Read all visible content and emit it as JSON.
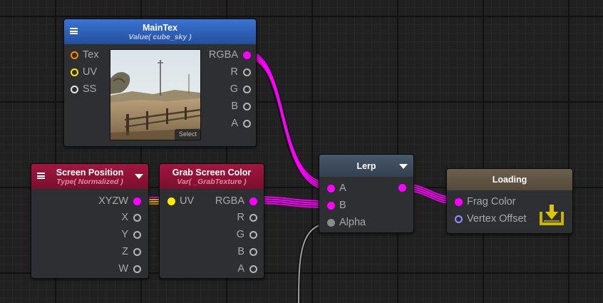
{
  "nodes": {
    "main_tex": {
      "title": "MainTex",
      "subtitle": "Value( cube_sky )",
      "inputs": [
        "Tex",
        "UV",
        "SS"
      ],
      "outputs": [
        "RGBA",
        "R",
        "G",
        "B",
        "A"
      ],
      "select_label": "Select"
    },
    "screen_position": {
      "title": "Screen Position",
      "subtitle": "Type( Normalized )",
      "outputs": [
        "XYZW",
        "X",
        "Y",
        "Z",
        "W"
      ]
    },
    "grab_screen_color": {
      "title": "Grab Screen Color",
      "subtitle": "Var( _GrabTexture )",
      "inputs": [
        "UV"
      ],
      "outputs": [
        "RGBA",
        "R",
        "G",
        "B",
        "A"
      ]
    },
    "lerp": {
      "title": "Lerp",
      "inputs": [
        "A",
        "B",
        "Alpha"
      ]
    },
    "output": {
      "title": "Loading",
      "inputs": [
        "Frag Color",
        "Vertex Offset"
      ]
    }
  },
  "colors": {
    "canvas_bg": "#202020",
    "node_body": "#2e2f32",
    "texture_header": "#2f66c4",
    "screen_header": "#8d1235",
    "lerp_header": "#3c4a58",
    "output_header": "#5f5444",
    "wire_color": "#ff00ff",
    "wire_vector": "#ffe000",
    "wire_scalar": "#a0a0a0",
    "port_label": "#a9a9a9"
  },
  "icons": {
    "menu": "hamburger-menu-icon",
    "dropdown": "triangle-down-icon",
    "save": "download-tray-icon"
  }
}
